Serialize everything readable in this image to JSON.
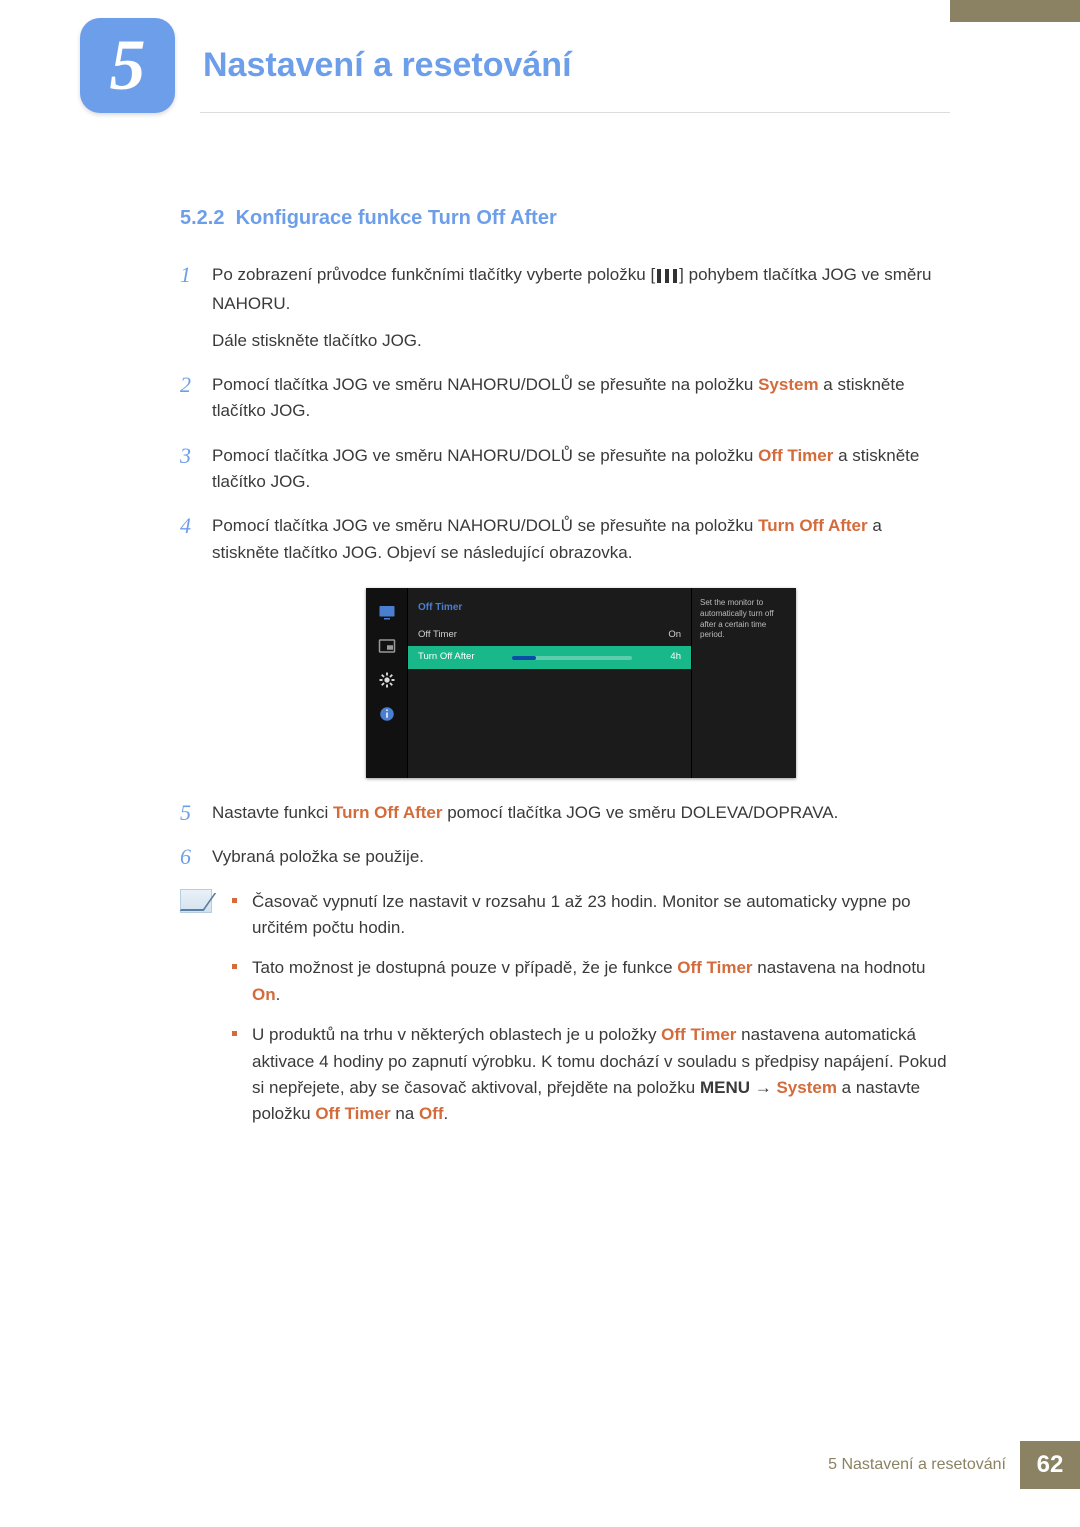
{
  "chapter": {
    "number": "5",
    "title": "Nastavení a resetování"
  },
  "section": {
    "number": "5.2.2",
    "title": "Konfigurace funkce Turn Off After"
  },
  "steps": {
    "s1": {
      "a": "Po zobrazení průvodce funkčními tlačítky vyberte položku [",
      "b": "] pohybem tlačítka JOG ve směru NAHORU.",
      "c": "Dále stiskněte tlačítko JOG."
    },
    "s2": {
      "a": "Pomocí tlačítka JOG ve směru NAHORU/DOLŮ se přesuňte na položku ",
      "b": "System",
      "c": " a stiskněte tlačítko JOG."
    },
    "s3": {
      "a": "Pomocí tlačítka JOG ve směru NAHORU/DOLŮ se přesuňte na položku ",
      "b": "Off Timer",
      "c": " a stiskněte tlačítko JOG."
    },
    "s4": {
      "a": "Pomocí tlačítka JOG ve směru NAHORU/DOLŮ se přesuňte na položku ",
      "b": "Turn Off After",
      "c": " a stiskněte tlačítko JOG. Objeví se následující obrazovka."
    },
    "s5": {
      "a": "Nastavte funkci ",
      "b": "Turn Off After",
      "c": " pomocí tlačítka JOG ve směru DOLEVA/DOPRAVA."
    },
    "s6": {
      "a": "Vybraná položka se použije."
    }
  },
  "osd": {
    "title": "Off Timer",
    "row1_label": "Off Timer",
    "row1_value": "On",
    "row2_label": "Turn Off After",
    "row2_value": "4h",
    "tip": "Set the monitor to automatically turn off after a certain time period."
  },
  "notes": {
    "n1": "Časovač vypnutí lze nastavit v rozsahu 1 až 23 hodin. Monitor se automaticky vypne po určitém počtu hodin.",
    "n2": {
      "a": "Tato možnost je dostupná pouze v případě, že je funkce ",
      "b": "Off Timer",
      "c": " nastavena na hodnotu ",
      "d": "On",
      "e": "."
    },
    "n3": {
      "a": "U produktů na trhu v některých oblastech je u položky ",
      "b": "Off Timer",
      "c": " nastavena automatická aktivace 4 hodiny po zapnutí výrobku. K tomu dochází v souladu s předpisy napájení. Pokud si nepřejete, aby se časovač aktivoval, přejděte na položku ",
      "d": "MENU",
      "e": " ",
      "arrow": "→",
      "f": " ",
      "g": "System",
      "h": " a nastavte položku ",
      "i": "Off Timer",
      "j": " na ",
      "k": "Off",
      "l": "."
    }
  },
  "footer": {
    "running": "5 Nastavení a resetování",
    "page": "62"
  }
}
